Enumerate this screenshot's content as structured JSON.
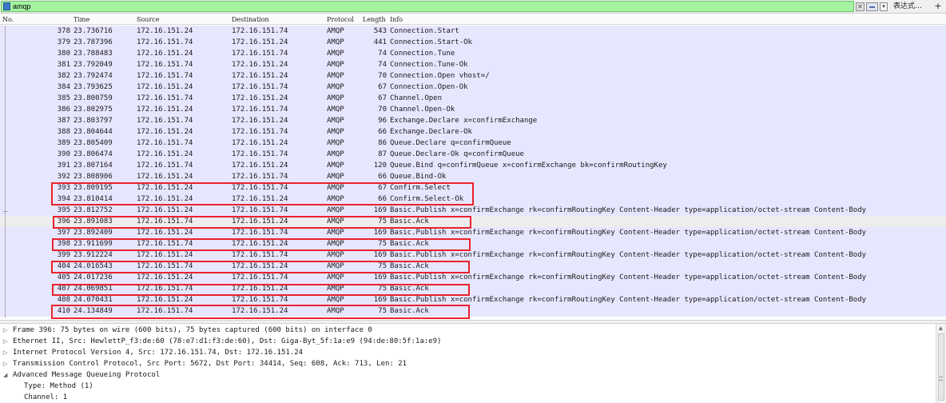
{
  "filter": {
    "value": "amqp",
    "clear_glyph": "✕",
    "dropdown_glyph": "▾",
    "expression_label": "表达式…",
    "add_label": "+",
    "bookmark_icon": "bookmark-icon",
    "bg_color": "#a5f2a1"
  },
  "columns": [
    "No.",
    "Time",
    "Source",
    "Destination",
    "Protocol",
    "Length",
    "Info"
  ],
  "packets": [
    {
      "no": "378",
      "time": "23.736716",
      "src": "172.16.151.24",
      "dst": "172.16.151.74",
      "proto": "AMQP",
      "len": "543",
      "info": "Connection.Start"
    },
    {
      "no": "379",
      "time": "23.787396",
      "src": "172.16.151.74",
      "dst": "172.16.151.24",
      "proto": "AMQP",
      "len": "441",
      "info": "Connection.Start-Ok"
    },
    {
      "no": "380",
      "time": "23.788483",
      "src": "172.16.151.24",
      "dst": "172.16.151.74",
      "proto": "AMQP",
      "len": "74",
      "info": "Connection.Tune"
    },
    {
      "no": "381",
      "time": "23.792049",
      "src": "172.16.151.74",
      "dst": "172.16.151.24",
      "proto": "AMQP",
      "len": "74",
      "info": "Connection.Tune-Ok"
    },
    {
      "no": "382",
      "time": "23.792474",
      "src": "172.16.151.74",
      "dst": "172.16.151.24",
      "proto": "AMQP",
      "len": "70",
      "info": "Connection.Open vhost=/"
    },
    {
      "no": "384",
      "time": "23.793625",
      "src": "172.16.151.24",
      "dst": "172.16.151.74",
      "proto": "AMQP",
      "len": "67",
      "info": "Connection.Open-Ok"
    },
    {
      "no": "385",
      "time": "23.800759",
      "src": "172.16.151.74",
      "dst": "172.16.151.24",
      "proto": "AMQP",
      "len": "67",
      "info": "Channel.Open"
    },
    {
      "no": "386",
      "time": "23.802975",
      "src": "172.16.151.24",
      "dst": "172.16.151.74",
      "proto": "AMQP",
      "len": "70",
      "info": "Channel.Open-Ok"
    },
    {
      "no": "387",
      "time": "23.803797",
      "src": "172.16.151.74",
      "dst": "172.16.151.24",
      "proto": "AMQP",
      "len": "96",
      "info": "Exchange.Declare x=confirmExchange"
    },
    {
      "no": "388",
      "time": "23.804644",
      "src": "172.16.151.24",
      "dst": "172.16.151.74",
      "proto": "AMQP",
      "len": "66",
      "info": "Exchange.Declare-Ok"
    },
    {
      "no": "389",
      "time": "23.805409",
      "src": "172.16.151.74",
      "dst": "172.16.151.24",
      "proto": "AMQP",
      "len": "86",
      "info": "Queue.Declare q=confirmQueue"
    },
    {
      "no": "390",
      "time": "23.806474",
      "src": "172.16.151.24",
      "dst": "172.16.151.74",
      "proto": "AMQP",
      "len": "87",
      "info": "Queue.Declare-Ok q=confirmQueue"
    },
    {
      "no": "391",
      "time": "23.807164",
      "src": "172.16.151.74",
      "dst": "172.16.151.24",
      "proto": "AMQP",
      "len": "120",
      "info": "Queue.Bind q=confirmQueue x=confirmExchange bk=confirmRoutingKey"
    },
    {
      "no": "392",
      "time": "23.808906",
      "src": "172.16.151.24",
      "dst": "172.16.151.74",
      "proto": "AMQP",
      "len": "66",
      "info": "Queue.Bind-Ok"
    },
    {
      "no": "393",
      "time": "23.809195",
      "src": "172.16.151.24",
      "dst": "172.16.151.74",
      "proto": "AMQP",
      "len": "67",
      "info": "Confirm.Select"
    },
    {
      "no": "394",
      "time": "23.810414",
      "src": "172.16.151.24",
      "dst": "172.16.151.24",
      "proto": "AMQP",
      "len": "66",
      "info": "Confirm.Select-Ok"
    },
    {
      "no": "395",
      "time": "23.812752",
      "src": "172.16.151.24",
      "dst": "172.16.151.74",
      "proto": "AMQP",
      "len": "169",
      "info": "Basic.Publish x=confirmExchange rk=confirmRoutingKey Content-Header type=application/octet-stream Content-Body"
    },
    {
      "no": "396",
      "time": "23.891083",
      "src": "172.16.151.74",
      "dst": "172.16.151.24",
      "proto": "AMQP",
      "len": "75",
      "info": "Basic.Ack"
    },
    {
      "no": "397",
      "time": "23.892409",
      "src": "172.16.151.24",
      "dst": "172.16.151.74",
      "proto": "AMQP",
      "len": "169",
      "info": "Basic.Publish x=confirmExchange rk=confirmRoutingKey Content-Header type=application/octet-stream Content-Body"
    },
    {
      "no": "398",
      "time": "23.911699",
      "src": "172.16.151.74",
      "dst": "172.16.151.24",
      "proto": "AMQP",
      "len": "75",
      "info": "Basic.Ack"
    },
    {
      "no": "399",
      "time": "23.912224",
      "src": "172.16.151.24",
      "dst": "172.16.151.74",
      "proto": "AMQP",
      "len": "169",
      "info": "Basic.Publish x=confirmExchange rk=confirmRoutingKey Content-Header type=application/octet-stream Content-Body"
    },
    {
      "no": "404",
      "time": "24.016543",
      "src": "172.16.151.74",
      "dst": "172.16.151.24",
      "proto": "AMQP",
      "len": "75",
      "info": "Basic.Ack"
    },
    {
      "no": "405",
      "time": "24.017236",
      "src": "172.16.151.24",
      "dst": "172.16.151.74",
      "proto": "AMQP",
      "len": "169",
      "info": "Basic.Publish x=confirmExchange rk=confirmRoutingKey Content-Header type=application/octet-stream Content-Body"
    },
    {
      "no": "407",
      "time": "24.069851",
      "src": "172.16.151.74",
      "dst": "172.16.151.24",
      "proto": "AMQP",
      "len": "75",
      "info": "Basic.Ack"
    },
    {
      "no": "408",
      "time": "24.070431",
      "src": "172.16.151.24",
      "dst": "172.16.151.74",
      "proto": "AMQP",
      "len": "169",
      "info": "Basic.Publish x=confirmExchange rk=confirmRoutingKey Content-Header type=application/octet-stream Content-Body"
    },
    {
      "no": "410",
      "time": "24.134849",
      "src": "172.16.151.74",
      "dst": "172.16.151.24",
      "proto": "AMQP",
      "len": "75",
      "info": "Basic.Ack"
    }
  ],
  "selected_packet": "396",
  "details": [
    {
      "arrow": "▷",
      "text": "Frame 396: 75 bytes on wire (600 bits), 75 bytes captured (600 bits) on interface 0"
    },
    {
      "arrow": "▷",
      "text": "Ethernet II, Src: HewlettP_f3:de:60 (78:e7:d1:f3:de:60), Dst: Giga-Byt_5f:1a:e9 (94:de:80:5f:1a:e9)"
    },
    {
      "arrow": "▷",
      "text": "Internet Protocol Version 4, Src: 172.16.151.74, Dst: 172.16.151.24"
    },
    {
      "arrow": "▷",
      "text": "Transmission Control Protocol, Src Port: 5672, Dst Port: 34414, Seq: 608, Ack: 713, Len: 21"
    },
    {
      "arrow": "◢",
      "text": "Advanced Message Queueing Protocol"
    },
    {
      "arrow": "",
      "text": "Type: Method (1)",
      "child": true
    },
    {
      "arrow": "",
      "text": "Channel: 1",
      "child": true
    }
  ],
  "colors": {
    "row_bg": "#e7e6ff",
    "selected_row_bg": "#ededed",
    "highlight_box": "#e8232e"
  }
}
